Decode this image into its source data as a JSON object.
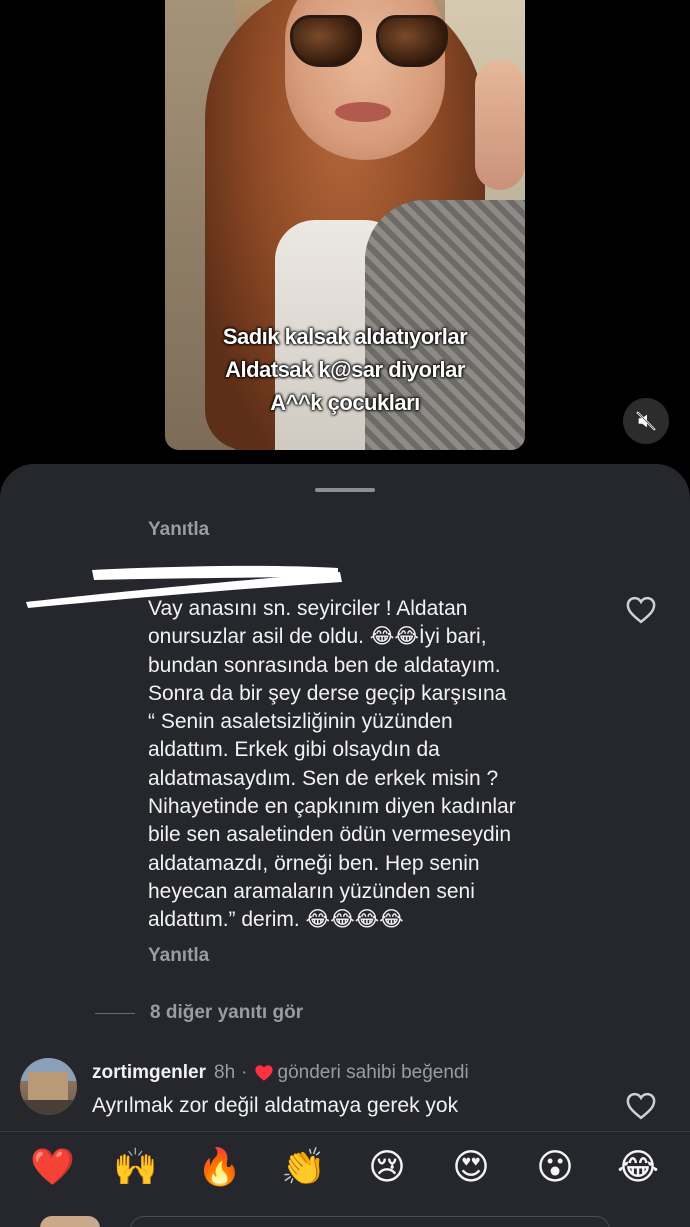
{
  "video": {
    "caption_lines": [
      "Sadık kalsak aldatıyorlar",
      "Aldatsak k@sar diyorlar",
      "A^^k çocukları"
    ],
    "mute_icon": "speaker-muted-icon"
  },
  "comments": {
    "reply_label_1": "Yanıtla",
    "comment_1": {
      "text": "Vay anasını sn. seyirciler ! Aldatan\nonursuzlar asil de oldu. 😂😂İyi bari,\nbundan sonrasında ben de aldatayım.\nSonra da bir şey derse geçip karşısına\n“ Senin asaletsizliğinin yüzünden\naldattım. Erkek gibi olsaydın da\naldatmasaydım. Sen de erkek misin ?\nNihayetinde en çapkınım diyen kadınlar\nbile sen asaletinden ödün vermeseydin\naldatamazdı, örneği ben. Hep senin\nheyecan aramaların yüzünden seni\naldattım.” derim. 😂😂😂😂",
      "reply_label": "Yanıtla"
    },
    "more_replies": "8 diğer yanıtı gör",
    "comment_2": {
      "username": "zortimgenler",
      "time": "8h",
      "separator": "·",
      "liked_by_author": "gönderi sahibi beğendi",
      "text": "Ayrılmak zor değil aldatmaya gerek yok"
    }
  },
  "emoji_bar": [
    "❤️",
    "🙌",
    "🔥",
    "👏",
    "😢",
    "😍",
    "😮",
    "😂"
  ],
  "colors": {
    "sheet_bg": "#25272d",
    "secondary_text": "#9a9ca1",
    "like_red": "#ff3040"
  }
}
